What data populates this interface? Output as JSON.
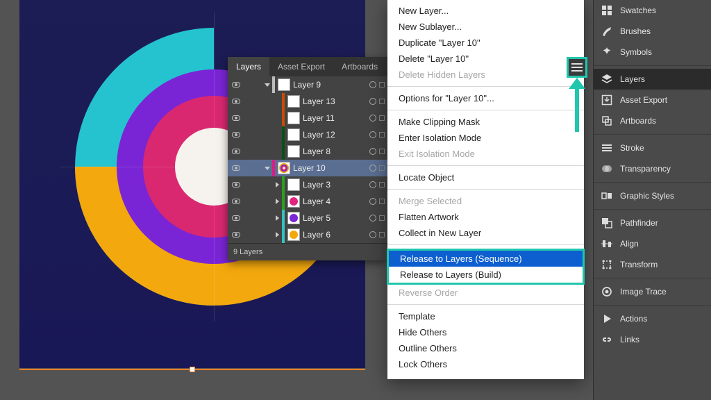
{
  "panels": {
    "layers": {
      "tabs": [
        "Layers",
        "Asset Export",
        "Artboards"
      ],
      "active_tab": 0,
      "footer": "9 Layers",
      "rows": [
        {
          "name": "Layer 9",
          "depth": 1,
          "caret": "down",
          "stripe": "#bdbdbd",
          "swatch_bg": "#ffffff",
          "swatch_dot": null,
          "selected": false
        },
        {
          "name": "Layer 13",
          "depth": 2,
          "caret": null,
          "stripe": "#c94b00",
          "swatch_bg": "#ffffff",
          "swatch_dot": null,
          "selected": false
        },
        {
          "name": "Layer 11",
          "depth": 2,
          "caret": null,
          "stripe": "#c94b00",
          "swatch_bg": "#ffffff",
          "swatch_dot": null,
          "selected": false
        },
        {
          "name": "Layer 12",
          "depth": 2,
          "caret": null,
          "stripe": "#0a4f16",
          "swatch_bg": "#ffffff",
          "swatch_dot": null,
          "selected": false
        },
        {
          "name": "Layer 8",
          "depth": 2,
          "caret": null,
          "stripe": "#0a4f16",
          "swatch_bg": "#ffffff",
          "swatch_dot": null,
          "selected": false
        },
        {
          "name": "Layer 10",
          "depth": 1,
          "caret": "down",
          "stripe": "#e21a86",
          "swatch_bg": "ring",
          "swatch_dot": null,
          "selected": true
        },
        {
          "name": "Layer 3",
          "depth": 2,
          "caret": "right",
          "stripe": "#2aa020",
          "swatch_bg": "#ffffff",
          "swatch_dot": null,
          "selected": false
        },
        {
          "name": "Layer 4",
          "depth": 2,
          "caret": "right",
          "stripe": "#2aa020",
          "swatch_bg": "#ffffff",
          "swatch_dot": "#e02580",
          "selected": false
        },
        {
          "name": "Layer 5",
          "depth": 2,
          "caret": "right",
          "stripe": "#35c2bc",
          "swatch_bg": "#ffffff",
          "swatch_dot": "#7b26d8",
          "selected": false
        },
        {
          "name": "Layer 6",
          "depth": 2,
          "caret": "right",
          "stripe": "#35c2bc",
          "swatch_bg": "#ffffff",
          "swatch_dot": "#f3a80d",
          "selected": false
        }
      ]
    }
  },
  "context_menu": {
    "groups": [
      [
        {
          "label": "New Layer...",
          "enabled": true
        },
        {
          "label": "New Sublayer...",
          "enabled": true
        },
        {
          "label": "Duplicate \"Layer 10\"",
          "enabled": true
        },
        {
          "label": "Delete \"Layer 10\"",
          "enabled": true
        },
        {
          "label": "Delete Hidden Layers",
          "enabled": false
        }
      ],
      [
        {
          "label": "Options for \"Layer 10\"...",
          "enabled": true
        }
      ],
      [
        {
          "label": "Make Clipping Mask",
          "enabled": true
        },
        {
          "label": "Enter Isolation Mode",
          "enabled": true
        },
        {
          "label": "Exit Isolation Mode",
          "enabled": false
        }
      ],
      [
        {
          "label": "Locate Object",
          "enabled": true
        }
      ],
      [
        {
          "label": "Merge Selected",
          "enabled": false
        },
        {
          "label": "Flatten Artwork",
          "enabled": true
        },
        {
          "label": "Collect in New Layer",
          "enabled": true
        }
      ],
      [
        {
          "label": "Release to Layers (Sequence)",
          "enabled": true,
          "highlight": true,
          "boxed": true
        },
        {
          "label": "Release to Layers (Build)",
          "enabled": true,
          "boxed": true
        },
        {
          "label": "Reverse Order",
          "enabled": false
        }
      ],
      [
        {
          "label": "Template",
          "enabled": true
        },
        {
          "label": "Hide Others",
          "enabled": true
        },
        {
          "label": "Outline Others",
          "enabled": true
        },
        {
          "label": "Lock Others",
          "enabled": true
        }
      ]
    ]
  },
  "dock": {
    "items": [
      {
        "label": "Swatches",
        "icon": "swatches"
      },
      {
        "label": "Brushes",
        "icon": "brushes"
      },
      {
        "label": "Symbols",
        "icon": "symbols"
      },
      {
        "sep": true
      },
      {
        "label": "Layers",
        "icon": "layers",
        "active": true
      },
      {
        "label": "Asset Export",
        "icon": "asset-export"
      },
      {
        "label": "Artboards",
        "icon": "artboards"
      },
      {
        "sep": true
      },
      {
        "label": "Stroke",
        "icon": "stroke"
      },
      {
        "label": "Transparency",
        "icon": "transparency"
      },
      {
        "sep": true
      },
      {
        "label": "Graphic Styles",
        "icon": "graphic-styles"
      },
      {
        "sep": true
      },
      {
        "label": "Pathfinder",
        "icon": "pathfinder"
      },
      {
        "label": "Align",
        "icon": "align"
      },
      {
        "label": "Transform",
        "icon": "transform"
      },
      {
        "sep": true
      },
      {
        "label": "Image Trace",
        "icon": "image-trace"
      },
      {
        "sep": true
      },
      {
        "label": "Actions",
        "icon": "actions"
      },
      {
        "label": "Links",
        "icon": "links"
      }
    ]
  },
  "artwork": {
    "colors": {
      "cyan": "#24c3cf",
      "purple": "#7a25d5",
      "pink": "#d9286f",
      "orange": "#f3a80d",
      "white": "#f6f3ee"
    }
  }
}
